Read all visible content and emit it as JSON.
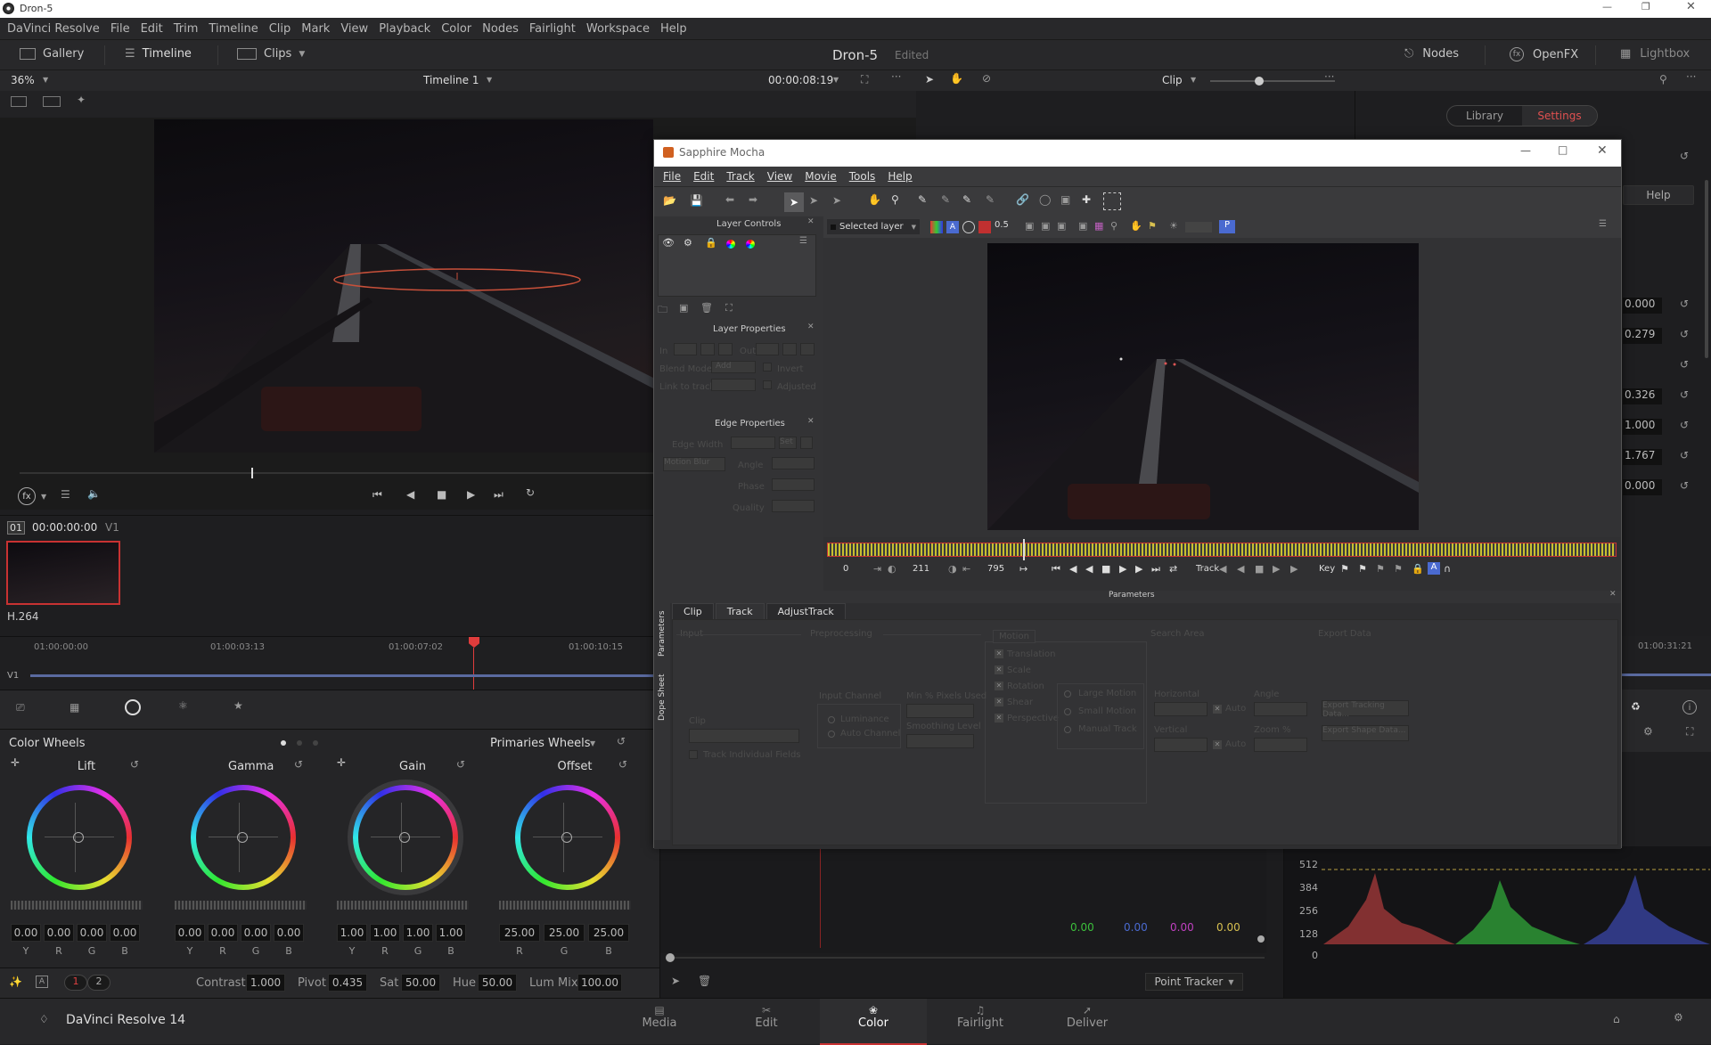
{
  "os_title": "Dron-5",
  "menu": [
    "DaVinci Resolve",
    "File",
    "Edit",
    "Trim",
    "Timeline",
    "Clip",
    "Mark",
    "View",
    "Playback",
    "Color",
    "Nodes",
    "Fairlight",
    "Workspace",
    "Help"
  ],
  "top": {
    "gallery": "Gallery",
    "timeline": "Timeline",
    "clips": "Clips",
    "project": "Dron-5",
    "status": "Edited",
    "nodes": "Nodes",
    "openfx": "OpenFX",
    "lightbox": "Lightbox"
  },
  "viewer": {
    "zoom": "36%",
    "timeline_name": "Timeline 1",
    "timecode": "00:00:08:19",
    "clip_mode": "Clip"
  },
  "right": {
    "library": "Library",
    "settings": "Settings",
    "help": "Help",
    "values": [
      "0.000",
      "0.279",
      "",
      "0.326",
      "1.000",
      "1.767",
      "0.000"
    ]
  },
  "clip": {
    "index": "01",
    "tc": "00:00:00:00",
    "track": "V1",
    "codec": "H.264"
  },
  "ruler": {
    "marks": [
      "01:00:00:00",
      "01:00:03:13",
      "01:00:07:02",
      "01:00:10:15"
    ],
    "right_mark": "01:00:31:21",
    "track": "V1"
  },
  "color": {
    "title": "Color Wheels",
    "mode": "Primaries Wheels",
    "wheels": [
      {
        "name": "Lift",
        "vals": [
          "0.00",
          "0.00",
          "0.00",
          "0.00"
        ],
        "lbls": [
          "Y",
          "R",
          "G",
          "B"
        ]
      },
      {
        "name": "Gamma",
        "vals": [
          "0.00",
          "0.00",
          "0.00",
          "0.00"
        ],
        "lbls": [
          "Y",
          "R",
          "G",
          "B"
        ]
      },
      {
        "name": "Gain",
        "vals": [
          "1.00",
          "1.00",
          "1.00",
          "1.00"
        ],
        "lbls": [
          "Y",
          "R",
          "G",
          "B"
        ]
      },
      {
        "name": "Offset",
        "vals": [
          "25.00",
          "25.00",
          "25.00"
        ],
        "lbls": [
          "R",
          "G",
          "B"
        ]
      }
    ],
    "page1": "1",
    "page2": "2",
    "contrast_l": "Contrast",
    "contrast": "1.000",
    "pivot_l": "Pivot",
    "pivot": "0.435",
    "sat_l": "Sat",
    "sat": "50.00",
    "hue_l": "Hue",
    "hue": "50.00",
    "lummix_l": "Lum Mix",
    "lummix": "100.00"
  },
  "tracker": {
    "vals": [
      "0.00",
      "0.00",
      "0.00",
      "0.00"
    ],
    "mode": "Point Tracker"
  },
  "scope": {
    "labels": [
      "512",
      "384",
      "256",
      "128",
      "0"
    ]
  },
  "pages": [
    "Media",
    "Edit",
    "Color",
    "Fairlight",
    "Deliver"
  ],
  "app_name": "DaVinci Resolve 14",
  "mocha": {
    "title": "Sapphire Mocha",
    "menu": [
      "File",
      "Edit",
      "Track",
      "View",
      "Movie",
      "Tools",
      "Help"
    ],
    "layer_controls": "Layer Controls",
    "layer_props": "Layer Properties",
    "edge_props": "Edge Properties",
    "in": "In",
    "out": "Out",
    "blend_mode": "Blend Mode",
    "blend_val": "Add",
    "invert": "Invert",
    "link_track": "Link to track",
    "adjusted": "Adjusted",
    "edge_width": "Edge Width",
    "set": "Set",
    "motion_blur": "Motion Blur",
    "angle": "Angle",
    "phase": "Phase",
    "quality": "Quality",
    "selected_layer": "Selected layer",
    "zoom_val": "0.5",
    "p": "P",
    "frame_start": "0",
    "frame_cur": "211",
    "frame_end": "795",
    "track": "Track",
    "key": "Key",
    "params": "Parameters",
    "tabs": [
      "Clip",
      "Track",
      "AdjustTrack"
    ],
    "side_tabs": [
      "Parameters",
      "Dope Sheet"
    ],
    "sections": {
      "input": "Input",
      "preproc": "Preprocessing",
      "motion": "Motion",
      "search": "Search Area",
      "export": "Export Data"
    },
    "clip_l": "Clip",
    "tif": "Track Individual Fields",
    "input_channel": "Input Channel",
    "luminance": "Luminance",
    "auto_channel": "Auto Channel",
    "min_pixels": "Min % Pixels Used",
    "smoothing": "Smoothing Level",
    "motion_opts": [
      "Translation",
      "Scale",
      "Rotation",
      "Shear",
      "Perspective"
    ],
    "motion_types": [
      "Large Motion",
      "Small Motion",
      "Manual Track"
    ],
    "horizontal": "Horizontal",
    "vertical": "Vertical",
    "auto": "Auto",
    "s_angle": "Angle",
    "zoom_pct": "Zoom %",
    "export_tracking": "Export Tracking Data...",
    "export_shape": "Export Shape Data..."
  }
}
